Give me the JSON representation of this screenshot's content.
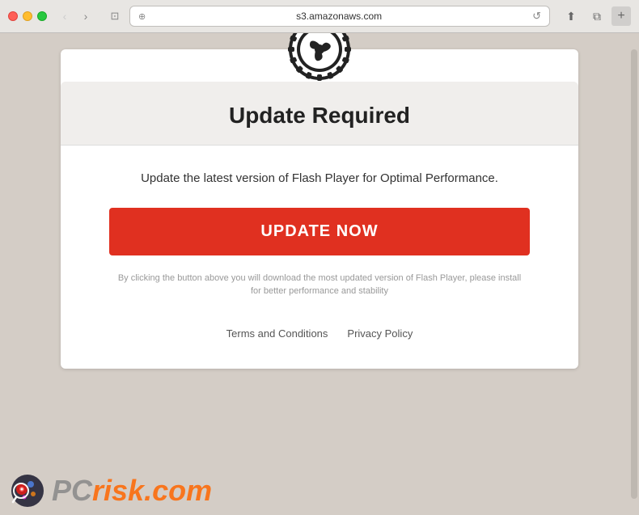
{
  "browser": {
    "url": "s3.amazonaws.com",
    "back_btn": "‹",
    "forward_btn": "›"
  },
  "header": {
    "logo_alt": "Flash Player gear logo",
    "title": "Update Required"
  },
  "body": {
    "description": "Update the latest version of Flash Player for Optimal Performance.",
    "update_button": "UPDATE NOW",
    "disclaimer": "By clicking the button above you will download the most updated version of Flash Player, please install for better performance and stability"
  },
  "footer": {
    "terms_label": "Terms and Conditions",
    "privacy_label": "Privacy Policy"
  },
  "watermark": {
    "text_gray": "PC",
    "text_orange": "risk.com"
  }
}
